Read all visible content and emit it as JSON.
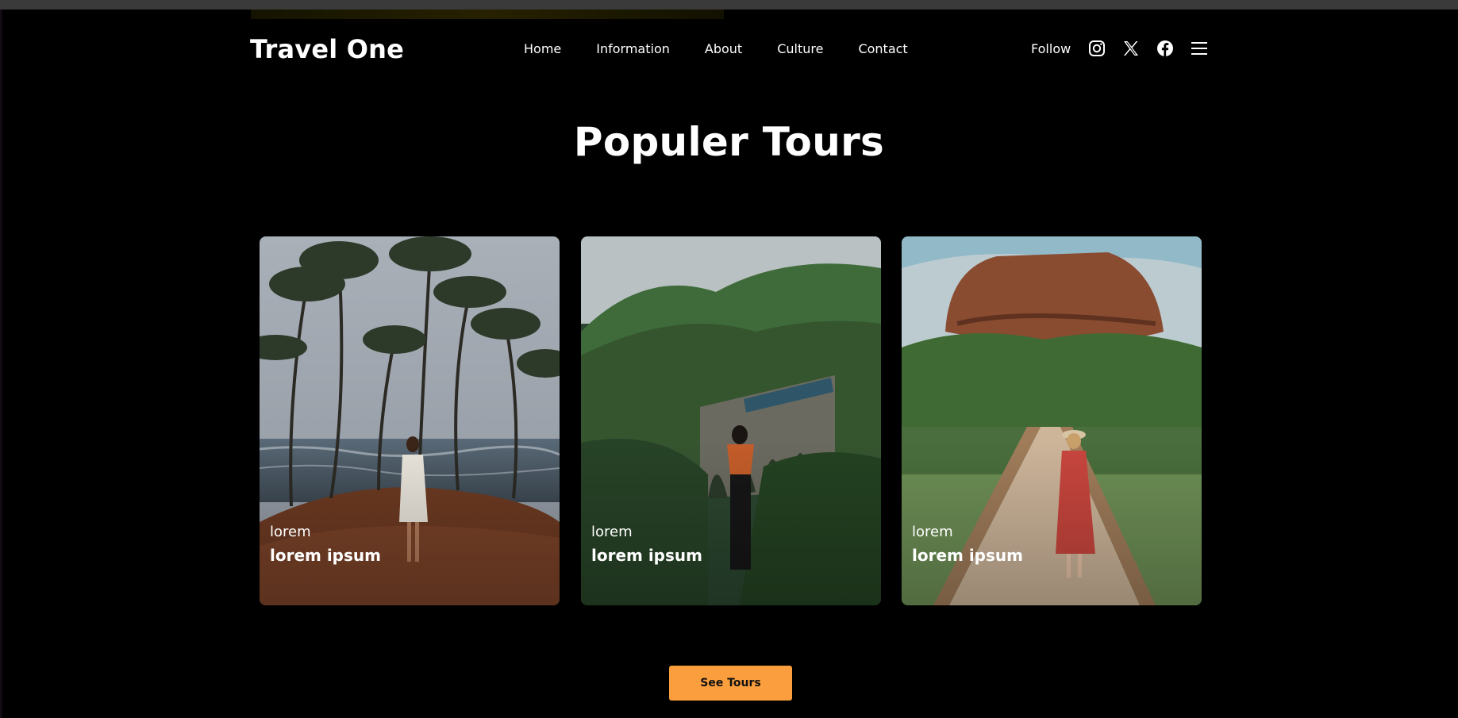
{
  "brand": "Travel One",
  "nav": {
    "items": [
      {
        "label": "Home"
      },
      {
        "label": "Information"
      },
      {
        "label": "About"
      },
      {
        "label": "Culture"
      },
      {
        "label": "Contact"
      }
    ],
    "follow_label": "Follow",
    "icons": [
      "instagram-icon",
      "x-icon",
      "facebook-icon",
      "menu-icon"
    ]
  },
  "section": {
    "heading": "Populer Tours"
  },
  "cards": [
    {
      "subtitle": "lorem",
      "title": "lorem ipsum",
      "scene": "palm-beach"
    },
    {
      "subtitle": "lorem",
      "title": "lorem ipsum",
      "scene": "train-bridge-hills"
    },
    {
      "subtitle": "lorem",
      "title": "lorem ipsum",
      "scene": "rock-fortress-path"
    }
  ],
  "cta": {
    "label": "See Tours"
  },
  "colors": {
    "background": "#000000",
    "accent": "#fb9e3d",
    "text": "#ffffff"
  }
}
